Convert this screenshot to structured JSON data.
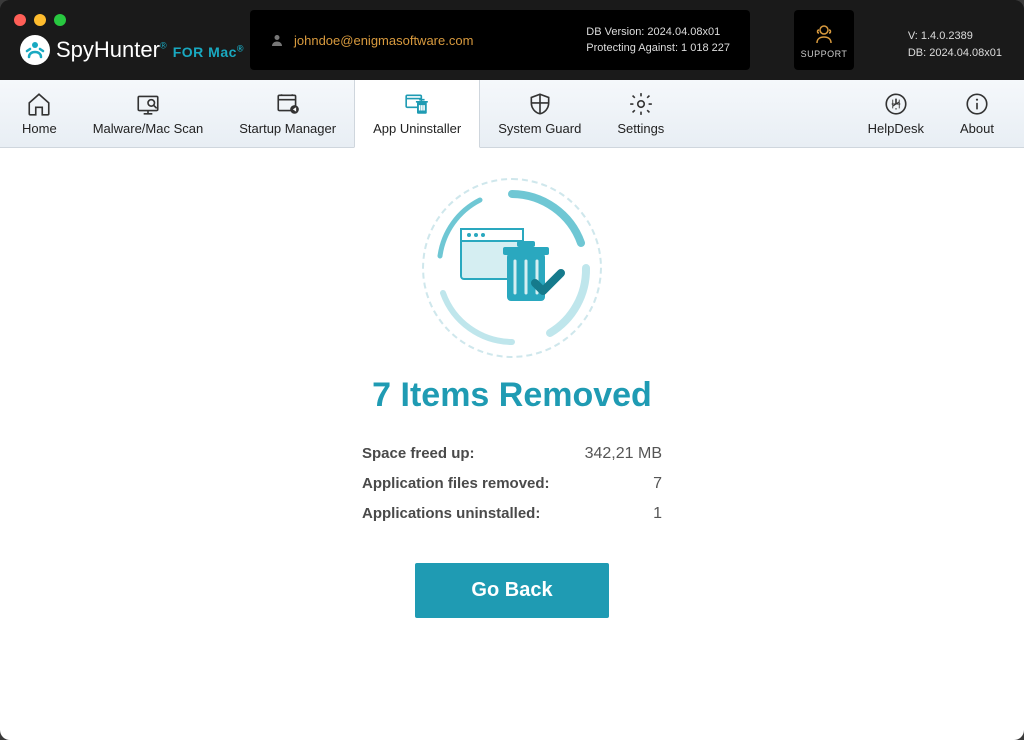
{
  "app": {
    "name_main": "SpyHunter",
    "name_sub": "FOR Mac"
  },
  "header": {
    "email": "johndoe@enigmasoftware.com",
    "db_version_label": "DB Version: 2024.04.08x01",
    "protecting_label": "Protecting Against: 1 018 227",
    "support_label": "SUPPORT",
    "version_line": "V: 1.4.0.2389",
    "db_line": "DB:  2024.04.08x01"
  },
  "tabs": {
    "home": "Home",
    "malware": "Malware/Mac Scan",
    "startup": "Startup Manager",
    "uninstaller": "App Uninstaller",
    "guard": "System Guard",
    "settings": "Settings",
    "helpdesk": "HelpDesk",
    "about": "About"
  },
  "result": {
    "headline": "7 Items Removed",
    "rows": [
      {
        "label": "Space freed up:",
        "value": "342,21 MB"
      },
      {
        "label": "Application files removed:",
        "value": "7"
      },
      {
        "label": "Applications uninstalled:",
        "value": "1"
      }
    ],
    "go_back": "Go Back"
  }
}
